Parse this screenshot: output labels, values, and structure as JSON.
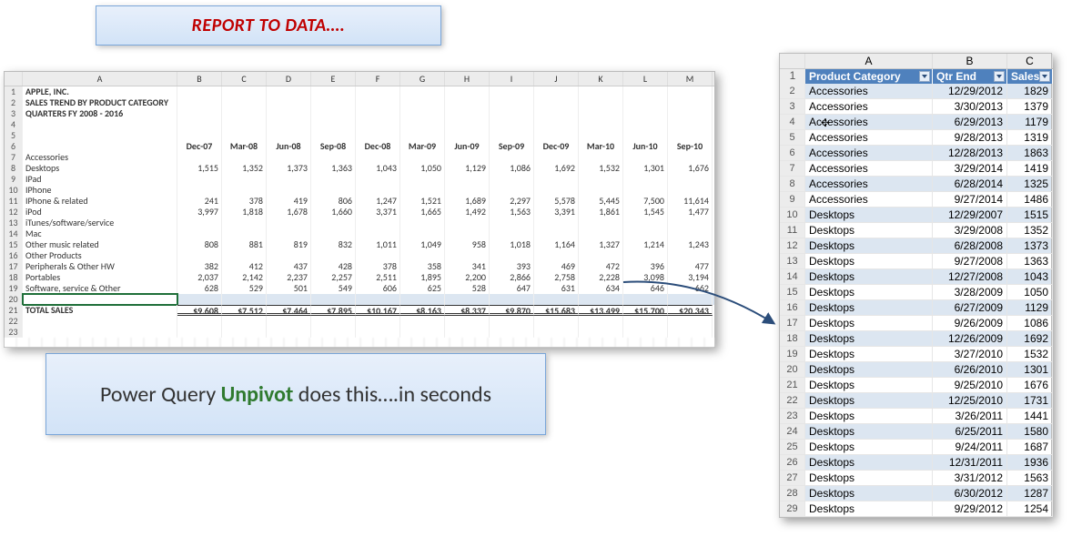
{
  "banner": {
    "title": "REPORT TO DATA…."
  },
  "caption": {
    "pre": "Power Query ",
    "keyword": "Unpivot",
    "post": " does this….in seconds"
  },
  "left": {
    "col_letters": [
      "A",
      "B",
      "C",
      "D",
      "E",
      "F",
      "G",
      "H",
      "I",
      "J",
      "K",
      "L",
      "M"
    ],
    "title1": "APPLE, INC.",
    "title2": "SALES TREND BY PRODUCT CATEGORY",
    "title3": "QUARTERS FY 2008 - 2016",
    "dates": [
      "Dec-07",
      "Mar-08",
      "Jun-08",
      "Sep-08",
      "Dec-08",
      "Mar-09",
      "Jun-09",
      "Sep-09",
      "Dec-09",
      "Mar-10",
      "Jun-10",
      "Sep-10"
    ],
    "rows": [
      {
        "rn": 7,
        "label": "Accessories",
        "vals": [
          "",
          "",
          "",
          "",
          "",
          "",
          "",
          "",
          "",
          "",
          "",
          ""
        ]
      },
      {
        "rn": 8,
        "label": "Desktops",
        "vals": [
          "1,515",
          "1,352",
          "1,373",
          "1,363",
          "1,043",
          "1,050",
          "1,129",
          "1,086",
          "1,692",
          "1,532",
          "1,301",
          "1,676"
        ]
      },
      {
        "rn": 9,
        "label": "IPad",
        "vals": [
          "",
          "",
          "",
          "",
          "",
          "",
          "",
          "",
          "",
          "",
          "",
          ""
        ]
      },
      {
        "rn": 10,
        "label": "IPhone",
        "vals": [
          "",
          "",
          "",
          "",
          "",
          "",
          "",
          "",
          "",
          "",
          "",
          ""
        ]
      },
      {
        "rn": 11,
        "label": "IPhone & related",
        "vals": [
          "241",
          "378",
          "419",
          "806",
          "1,247",
          "1,521",
          "1,689",
          "2,297",
          "5,578",
          "5,445",
          "7,500",
          "11,614"
        ]
      },
      {
        "rn": 12,
        "label": "iPod",
        "vals": [
          "3,997",
          "1,818",
          "1,678",
          "1,660",
          "3,371",
          "1,665",
          "1,492",
          "1,563",
          "3,391",
          "1,861",
          "1,545",
          "1,477"
        ]
      },
      {
        "rn": 13,
        "label": "iTunes/software/service",
        "vals": [
          "",
          "",
          "",
          "",
          "",
          "",
          "",
          "",
          "",
          "",
          "",
          ""
        ]
      },
      {
        "rn": 14,
        "label": "Mac",
        "vals": [
          "",
          "",
          "",
          "",
          "",
          "",
          "",
          "",
          "",
          "",
          "",
          ""
        ]
      },
      {
        "rn": 15,
        "label": "Other music related",
        "vals": [
          "808",
          "881",
          "819",
          "832",
          "1,011",
          "1,049",
          "958",
          "1,018",
          "1,164",
          "1,327",
          "1,214",
          "1,243"
        ]
      },
      {
        "rn": 16,
        "label": "Other Products",
        "vals": [
          "",
          "",
          "",
          "",
          "",
          "",
          "",
          "",
          "",
          "",
          "",
          ""
        ]
      },
      {
        "rn": 17,
        "label": "Peripherals & Other HW",
        "vals": [
          "382",
          "412",
          "437",
          "428",
          "378",
          "358",
          "341",
          "393",
          "469",
          "472",
          "396",
          "477"
        ]
      },
      {
        "rn": 18,
        "label": "Portables",
        "vals": [
          "2,037",
          "2,142",
          "2,237",
          "2,257",
          "2,511",
          "1,895",
          "2,200",
          "2,866",
          "2,758",
          "2,228",
          "3,098",
          "3,194"
        ]
      },
      {
        "rn": 19,
        "label": "Software, service & Other",
        "vals": [
          "628",
          "529",
          "501",
          "549",
          "606",
          "625",
          "528",
          "647",
          "631",
          "634",
          "646",
          "662"
        ]
      }
    ],
    "total_label": "TOTAL SALES",
    "totals": [
      "$9,608",
      "$7,512",
      "$7,464",
      "$7,895",
      "$10,167",
      "$8,163",
      "$8,337",
      "$9,870",
      "$15,683",
      "$13,499",
      "$15,700",
      "$20,343"
    ]
  },
  "right": {
    "col_letters": [
      "A",
      "B",
      "C"
    ],
    "headers": [
      "Product Category",
      "Qtr End",
      "Sales"
    ],
    "rows": [
      {
        "rn": 2,
        "cat": "Accessories",
        "date": "12/29/2012",
        "val": "1829"
      },
      {
        "rn": 3,
        "cat": "Accessories",
        "date": "3/30/2013",
        "val": "1379"
      },
      {
        "rn": 4,
        "cat": "Accessories",
        "date": "6/29/2013",
        "val": "1179"
      },
      {
        "rn": 5,
        "cat": "Accessories",
        "date": "9/28/2013",
        "val": "1319"
      },
      {
        "rn": 6,
        "cat": "Accessories",
        "date": "12/28/2013",
        "val": "1863"
      },
      {
        "rn": 7,
        "cat": "Accessories",
        "date": "3/29/2014",
        "val": "1419"
      },
      {
        "rn": 8,
        "cat": "Accessories",
        "date": "6/28/2014",
        "val": "1325"
      },
      {
        "rn": 9,
        "cat": "Accessories",
        "date": "9/27/2014",
        "val": "1486"
      },
      {
        "rn": 10,
        "cat": "Desktops",
        "date": "12/29/2007",
        "val": "1515"
      },
      {
        "rn": 11,
        "cat": "Desktops",
        "date": "3/29/2008",
        "val": "1352"
      },
      {
        "rn": 12,
        "cat": "Desktops",
        "date": "6/28/2008",
        "val": "1373"
      },
      {
        "rn": 13,
        "cat": "Desktops",
        "date": "9/27/2008",
        "val": "1363"
      },
      {
        "rn": 14,
        "cat": "Desktops",
        "date": "12/27/2008",
        "val": "1043"
      },
      {
        "rn": 15,
        "cat": "Desktops",
        "date": "3/28/2009",
        "val": "1050"
      },
      {
        "rn": 16,
        "cat": "Desktops",
        "date": "6/27/2009",
        "val": "1129"
      },
      {
        "rn": 17,
        "cat": "Desktops",
        "date": "9/26/2009",
        "val": "1086"
      },
      {
        "rn": 18,
        "cat": "Desktops",
        "date": "12/26/2009",
        "val": "1692"
      },
      {
        "rn": 19,
        "cat": "Desktops",
        "date": "3/27/2010",
        "val": "1532"
      },
      {
        "rn": 20,
        "cat": "Desktops",
        "date": "6/26/2010",
        "val": "1301"
      },
      {
        "rn": 21,
        "cat": "Desktops",
        "date": "9/25/2010",
        "val": "1676"
      },
      {
        "rn": 22,
        "cat": "Desktops",
        "date": "12/25/2010",
        "val": "1731"
      },
      {
        "rn": 23,
        "cat": "Desktops",
        "date": "3/26/2011",
        "val": "1441"
      },
      {
        "rn": 24,
        "cat": "Desktops",
        "date": "6/25/2011",
        "val": "1580"
      },
      {
        "rn": 25,
        "cat": "Desktops",
        "date": "9/24/2011",
        "val": "1687"
      },
      {
        "rn": 26,
        "cat": "Desktops",
        "date": "12/31/2011",
        "val": "1936"
      },
      {
        "rn": 27,
        "cat": "Desktops",
        "date": "3/31/2012",
        "val": "1563"
      },
      {
        "rn": 28,
        "cat": "Desktops",
        "date": "6/30/2012",
        "val": "1287"
      },
      {
        "rn": 29,
        "cat": "Desktops",
        "date": "9/29/2012",
        "val": "1254"
      }
    ]
  }
}
